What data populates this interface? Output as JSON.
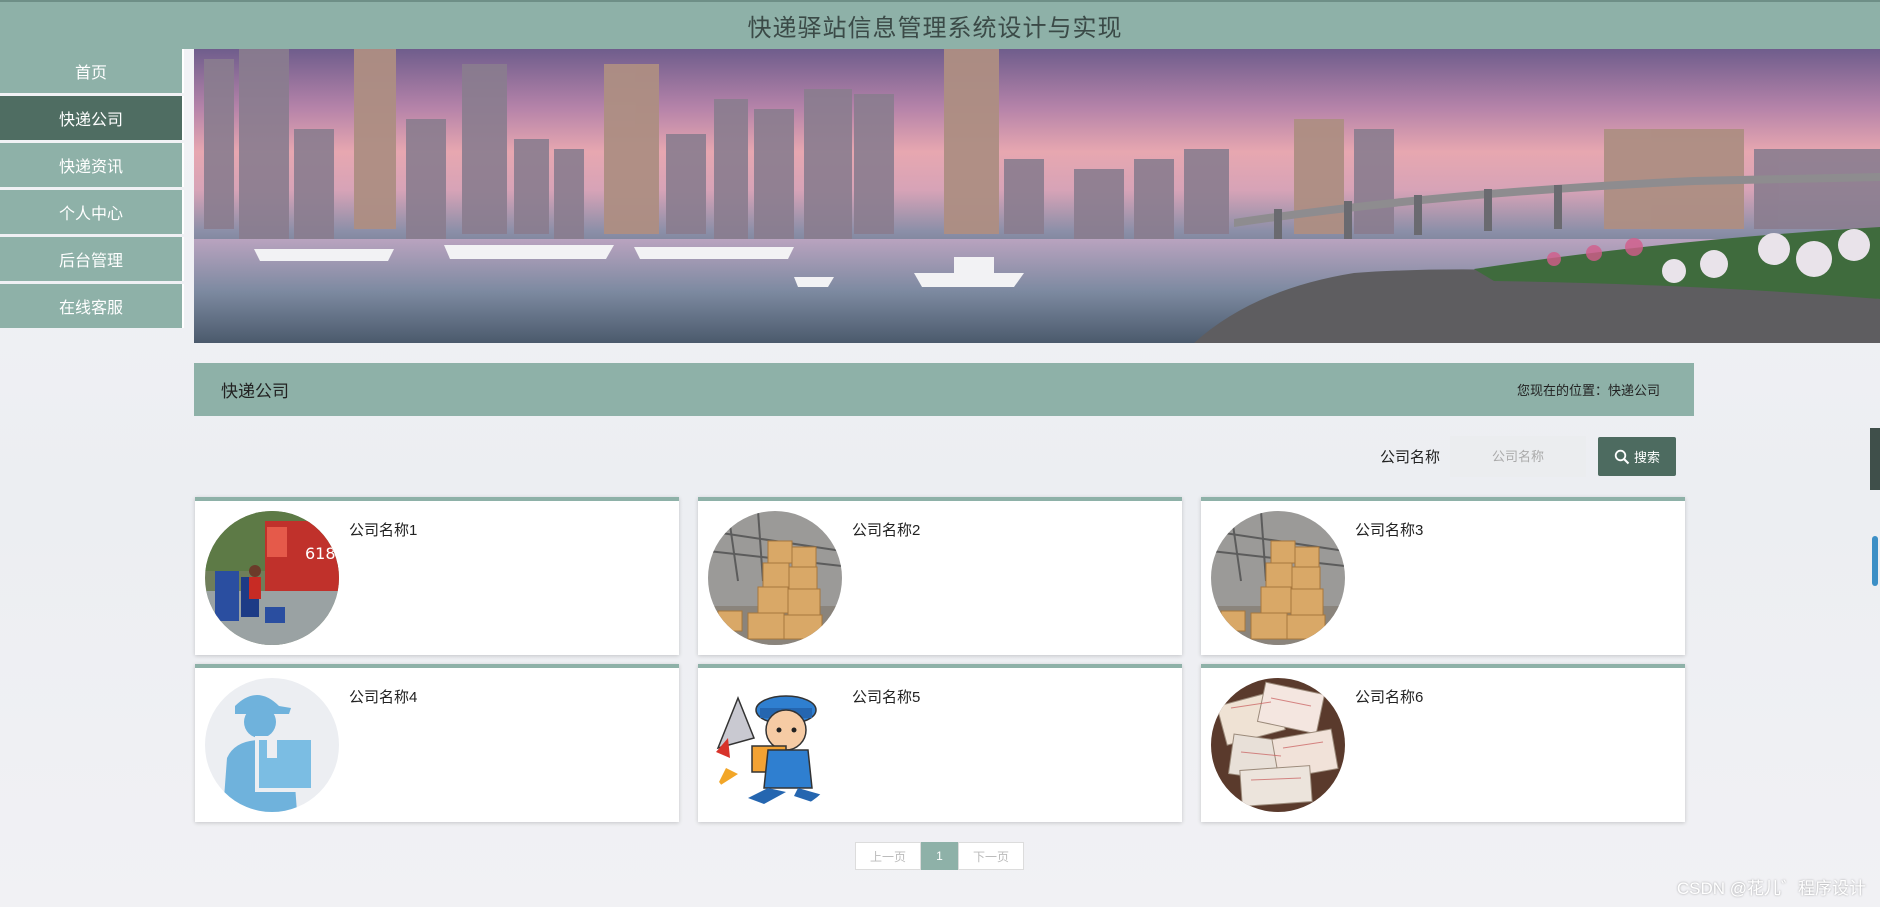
{
  "header": {
    "title": "快递驿站信息管理系统设计与实现"
  },
  "sidebar": {
    "items": [
      {
        "label": "首页",
        "active": false
      },
      {
        "label": "快递公司",
        "active": true
      },
      {
        "label": "快递资讯",
        "active": false
      },
      {
        "label": "个人中心",
        "active": false
      },
      {
        "label": "后台管理",
        "active": false
      },
      {
        "label": "在线客服",
        "active": false
      }
    ]
  },
  "section": {
    "title": "快递公司",
    "breadcrumb": "您现在的位置：快递公司"
  },
  "search": {
    "label": "公司名称",
    "placeholder": "公司名称",
    "button_label": "搜索"
  },
  "cards": [
    {
      "name": "公司名称1",
      "image": "delivery-truck-photo"
    },
    {
      "name": "公司名称2",
      "image": "warehouse-boxes-photo"
    },
    {
      "name": "公司名称3",
      "image": "warehouse-boxes-photo"
    },
    {
      "name": "公司名称4",
      "image": "courier-silhouette-icon"
    },
    {
      "name": "公司名称5",
      "image": "cartoon-courier-rocket"
    },
    {
      "name": "公司名称6",
      "image": "shipping-labels-photo"
    }
  ],
  "pagination": {
    "prev": "上一页",
    "current": "1",
    "next": "下一页"
  },
  "watermark": "CSDN @花儿゛程序设计",
  "colors": {
    "accent": "#8eb1a8",
    "active": "#4f6d62",
    "button": "#4d6b60"
  }
}
